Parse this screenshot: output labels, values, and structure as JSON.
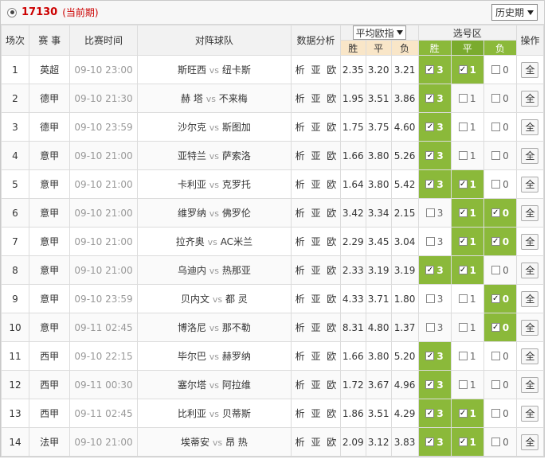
{
  "header": {
    "period_number": "17130",
    "period_tag": "(当前期)",
    "history_label": "历史期"
  },
  "columns": {
    "index": "场次",
    "league": "赛 事",
    "time": "比赛时间",
    "match": "对阵球队",
    "analysis": "数据分析",
    "odds_select": "平均欧指",
    "odds": [
      "胜",
      "平",
      "负"
    ],
    "selection": "选号区",
    "selection_sub": [
      "胜",
      "平",
      "负"
    ],
    "action": "操作"
  },
  "vs_label": "vs",
  "analysis_links": [
    "析",
    "亚",
    "欧"
  ],
  "action_label": "全",
  "colors": {
    "selected": "#8bb93a",
    "odds_header": "#f9e6c8",
    "period": "#cc0000"
  },
  "rows": [
    {
      "idx": "1",
      "league": "英超",
      "time": "09-10 23:00",
      "home": "斯旺西",
      "away": "纽卡斯",
      "odds": [
        "2.35",
        "3.20",
        "3.21"
      ],
      "sel": [
        {
          "on": true,
          "n": "3"
        },
        {
          "on": true,
          "n": "1"
        },
        {
          "on": false,
          "n": "0"
        }
      ]
    },
    {
      "idx": "2",
      "league": "德甲",
      "time": "09-10 21:30",
      "home": "赫 塔",
      "away": "不来梅",
      "odds": [
        "1.95",
        "3.51",
        "3.86"
      ],
      "sel": [
        {
          "on": true,
          "n": "3"
        },
        {
          "on": false,
          "n": "1"
        },
        {
          "on": false,
          "n": "0"
        }
      ]
    },
    {
      "idx": "3",
      "league": "德甲",
      "time": "09-10 23:59",
      "home": "沙尔克",
      "away": "斯图加",
      "odds": [
        "1.75",
        "3.75",
        "4.60"
      ],
      "sel": [
        {
          "on": true,
          "n": "3"
        },
        {
          "on": false,
          "n": "1"
        },
        {
          "on": false,
          "n": "0"
        }
      ]
    },
    {
      "idx": "4",
      "league": "意甲",
      "time": "09-10 21:00",
      "home": "亚特兰",
      "away": "萨索洛",
      "odds": [
        "1.66",
        "3.80",
        "5.26"
      ],
      "sel": [
        {
          "on": true,
          "n": "3"
        },
        {
          "on": false,
          "n": "1"
        },
        {
          "on": false,
          "n": "0"
        }
      ]
    },
    {
      "idx": "5",
      "league": "意甲",
      "time": "09-10 21:00",
      "home": "卡利亚",
      "away": "克罗托",
      "odds": [
        "1.64",
        "3.80",
        "5.42"
      ],
      "sel": [
        {
          "on": true,
          "n": "3"
        },
        {
          "on": true,
          "n": "1"
        },
        {
          "on": false,
          "n": "0"
        }
      ]
    },
    {
      "idx": "6",
      "league": "意甲",
      "time": "09-10 21:00",
      "home": "维罗纳",
      "away": "佛罗伦",
      "odds": [
        "3.42",
        "3.34",
        "2.15"
      ],
      "sel": [
        {
          "on": false,
          "n": "3"
        },
        {
          "on": true,
          "n": "1"
        },
        {
          "on": true,
          "n": "0"
        }
      ]
    },
    {
      "idx": "7",
      "league": "意甲",
      "time": "09-10 21:00",
      "home": "拉齐奥",
      "away": "AC米兰",
      "odds": [
        "2.29",
        "3.45",
        "3.04"
      ],
      "sel": [
        {
          "on": false,
          "n": "3"
        },
        {
          "on": true,
          "n": "1"
        },
        {
          "on": true,
          "n": "0"
        }
      ]
    },
    {
      "idx": "8",
      "league": "意甲",
      "time": "09-10 21:00",
      "home": "乌迪内",
      "away": "热那亚",
      "odds": [
        "2.33",
        "3.19",
        "3.19"
      ],
      "sel": [
        {
          "on": true,
          "n": "3"
        },
        {
          "on": true,
          "n": "1"
        },
        {
          "on": false,
          "n": "0"
        }
      ]
    },
    {
      "idx": "9",
      "league": "意甲",
      "time": "09-10 23:59",
      "home": "贝内文",
      "away": "都 灵",
      "odds": [
        "4.33",
        "3.71",
        "1.80"
      ],
      "sel": [
        {
          "on": false,
          "n": "3"
        },
        {
          "on": false,
          "n": "1"
        },
        {
          "on": true,
          "n": "0"
        }
      ]
    },
    {
      "idx": "10",
      "league": "意甲",
      "time": "09-11 02:45",
      "home": "博洛尼",
      "away": "那不勒",
      "odds": [
        "8.31",
        "4.80",
        "1.37"
      ],
      "sel": [
        {
          "on": false,
          "n": "3"
        },
        {
          "on": false,
          "n": "1"
        },
        {
          "on": true,
          "n": "0"
        }
      ]
    },
    {
      "idx": "11",
      "league": "西甲",
      "time": "09-10 22:15",
      "home": "毕尔巴",
      "away": "赫罗纳",
      "odds": [
        "1.66",
        "3.80",
        "5.20"
      ],
      "sel": [
        {
          "on": true,
          "n": "3"
        },
        {
          "on": false,
          "n": "1"
        },
        {
          "on": false,
          "n": "0"
        }
      ]
    },
    {
      "idx": "12",
      "league": "西甲",
      "time": "09-11 00:30",
      "home": "塞尔塔",
      "away": "阿拉维",
      "odds": [
        "1.72",
        "3.67",
        "4.96"
      ],
      "sel": [
        {
          "on": true,
          "n": "3"
        },
        {
          "on": false,
          "n": "1"
        },
        {
          "on": false,
          "n": "0"
        }
      ]
    },
    {
      "idx": "13",
      "league": "西甲",
      "time": "09-11 02:45",
      "home": "比利亚",
      "away": "贝蒂斯",
      "odds": [
        "1.86",
        "3.51",
        "4.29"
      ],
      "sel": [
        {
          "on": true,
          "n": "3"
        },
        {
          "on": true,
          "n": "1"
        },
        {
          "on": false,
          "n": "0"
        }
      ]
    },
    {
      "idx": "14",
      "league": "法甲",
      "time": "09-10 21:00",
      "home": "埃蒂安",
      "away": "昂 热",
      "odds": [
        "2.09",
        "3.12",
        "3.83"
      ],
      "sel": [
        {
          "on": true,
          "n": "3"
        },
        {
          "on": true,
          "n": "1"
        },
        {
          "on": false,
          "n": "0"
        }
      ]
    }
  ]
}
